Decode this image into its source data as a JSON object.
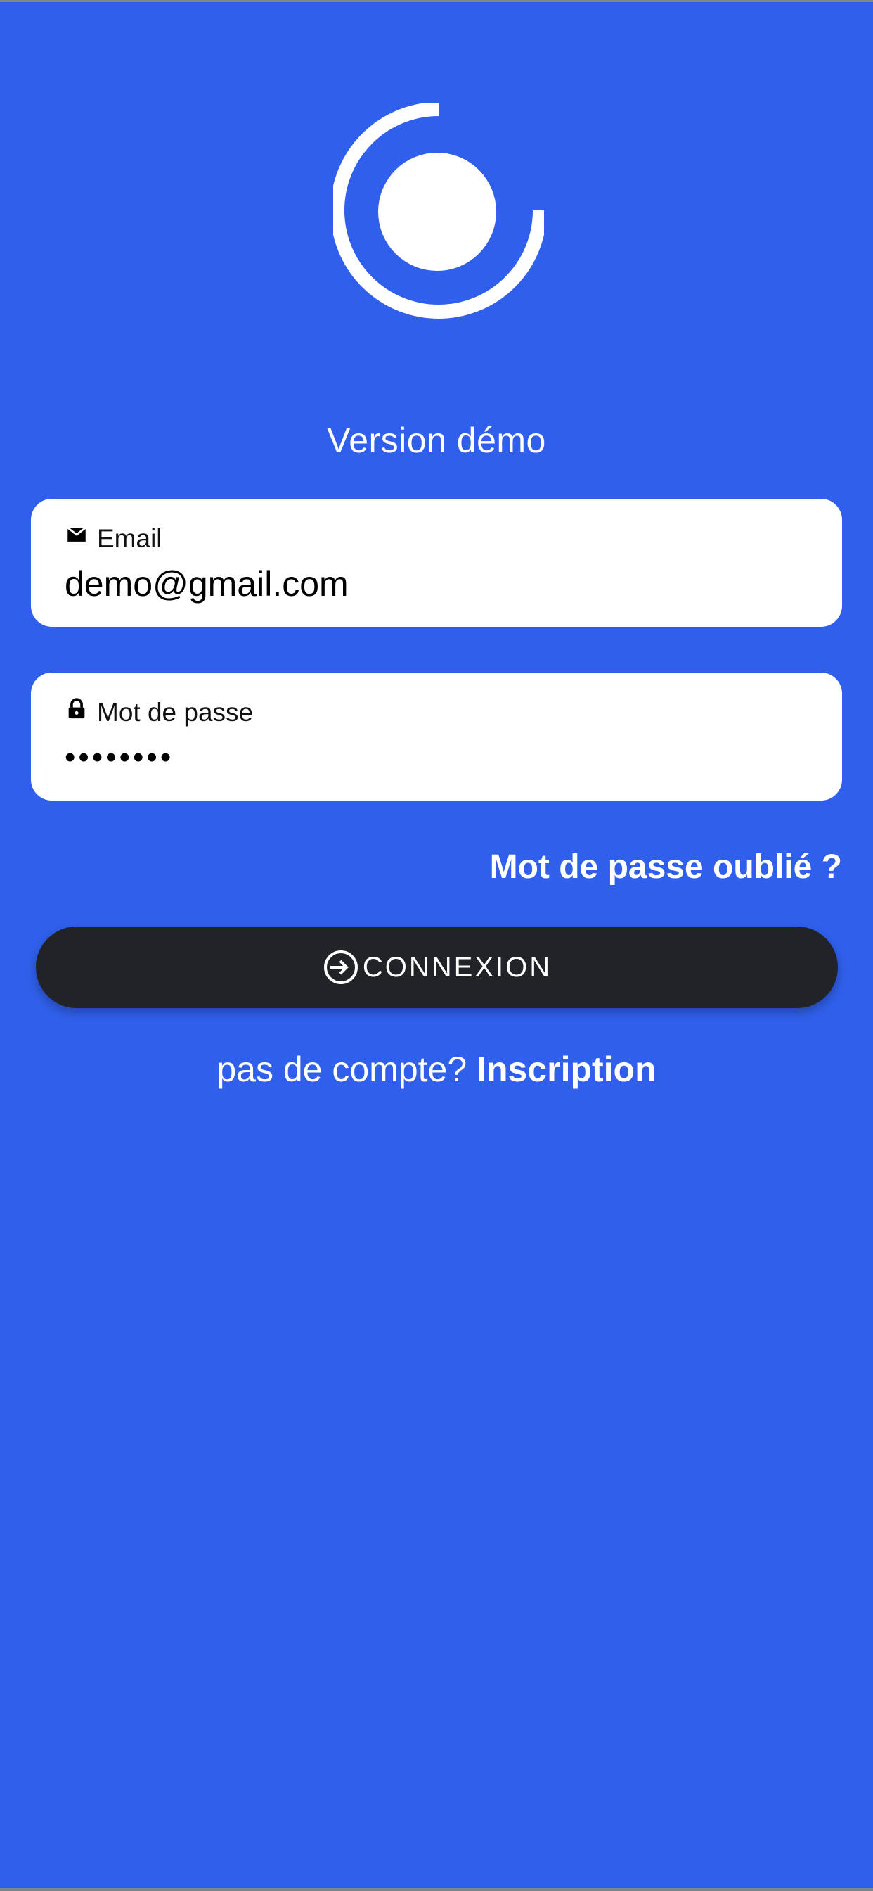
{
  "app": {
    "version_text": "Version démo"
  },
  "login": {
    "email": {
      "label": "Email",
      "value": "demo@gmail.com",
      "icon": "mail-icon"
    },
    "password": {
      "label": "Mot de passe",
      "value": "••••••••",
      "icon": "lock-icon"
    },
    "forgot_password": "Mot de passe oublié ?",
    "submit_label": "CONNEXION",
    "submit_icon": "login-icon",
    "no_account_text": "pas de compte?",
    "signup_link": "Inscription"
  },
  "colors": {
    "background": "#3060EB",
    "button": "#222327",
    "field": "#FFFFFF"
  }
}
